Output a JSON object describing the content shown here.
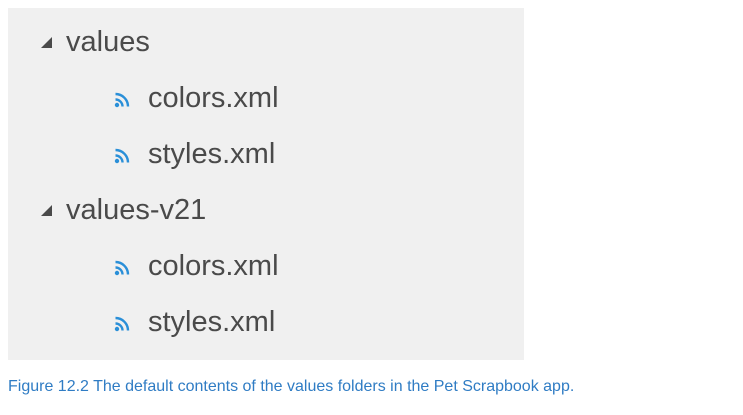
{
  "tree": [
    {
      "type": "folder",
      "label": "values",
      "expanded": true
    },
    {
      "type": "file",
      "label": "colors.xml"
    },
    {
      "type": "file",
      "label": "styles.xml"
    },
    {
      "type": "folder",
      "label": "values-v21",
      "expanded": true
    },
    {
      "type": "file",
      "label": "colors.xml"
    },
    {
      "type": "file",
      "label": "styles.xml"
    }
  ],
  "icons": {
    "folder_toggle": "expanded-triangle-icon",
    "file": "xml-file-icon"
  },
  "colors": {
    "panel_bg": "#f0f0f0",
    "text": "#4a4a4a",
    "file_icon": "#2a8fd8",
    "caption": "#2f7cc4"
  },
  "caption": "Figure 12.2 The default contents of the values folders in the Pet Scrapbook app."
}
